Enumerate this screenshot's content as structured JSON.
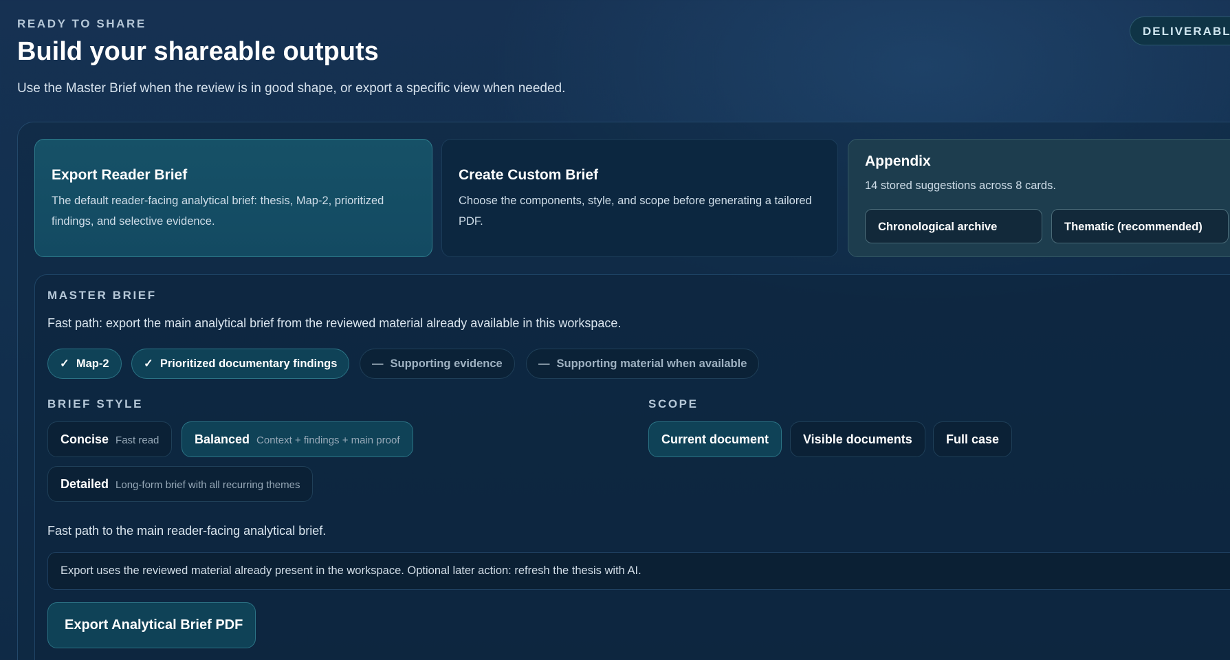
{
  "header": {
    "eyebrow": "READY TO SHARE",
    "title": "Build your shareable outputs",
    "subtitle": "Use the Master Brief when the review is in good shape, or export a specific view when needed.",
    "deliverable_pill": "DELIVERABL"
  },
  "cards": {
    "reader": {
      "title": "Export Reader Brief",
      "description": "The default reader-facing analytical brief: thesis, Map-2, prioritized findings, and selective evidence."
    },
    "custom": {
      "title": "Create Custom Brief",
      "description": "Choose the components, style, and scope before generating a tailored PDF."
    },
    "appendix": {
      "title": "Appendix",
      "description": "14 stored suggestions across 8 cards.",
      "chronological_label": "Chronological archive",
      "thematic_label": "Thematic (recommended)"
    }
  },
  "master_brief": {
    "label": "MASTER BRIEF",
    "description": "Fast path: export the main analytical brief from the reviewed material already available in this workspace.",
    "components": [
      {
        "mark": "✓",
        "label": "Map-2",
        "selected": true
      },
      {
        "mark": "✓",
        "label": "Prioritized documentary findings",
        "selected": true
      },
      {
        "mark": "—",
        "label": "Supporting evidence",
        "selected": false
      },
      {
        "mark": "—",
        "label": "Supporting material when available",
        "selected": false
      }
    ],
    "style_label": "BRIEF STYLE",
    "styles": [
      {
        "name": "Concise",
        "hint": "Fast read",
        "selected": false
      },
      {
        "name": "Balanced",
        "hint": "Context + findings + main proof",
        "selected": true
      },
      {
        "name": "Detailed",
        "hint": "Long-form brief with all recurring themes",
        "selected": false
      }
    ],
    "scope_label": "SCOPE",
    "scopes": [
      {
        "name": "Current document",
        "selected": true
      },
      {
        "name": "Visible documents",
        "selected": false
      },
      {
        "name": "Full case",
        "selected": false
      }
    ],
    "fast_path_text": "Fast path to the main reader-facing analytical brief.",
    "note": "Export uses the reviewed material already present in the workspace. Optional later action: refresh the thesis with AI.",
    "export_button": "Export Analytical Brief PDF"
  }
}
